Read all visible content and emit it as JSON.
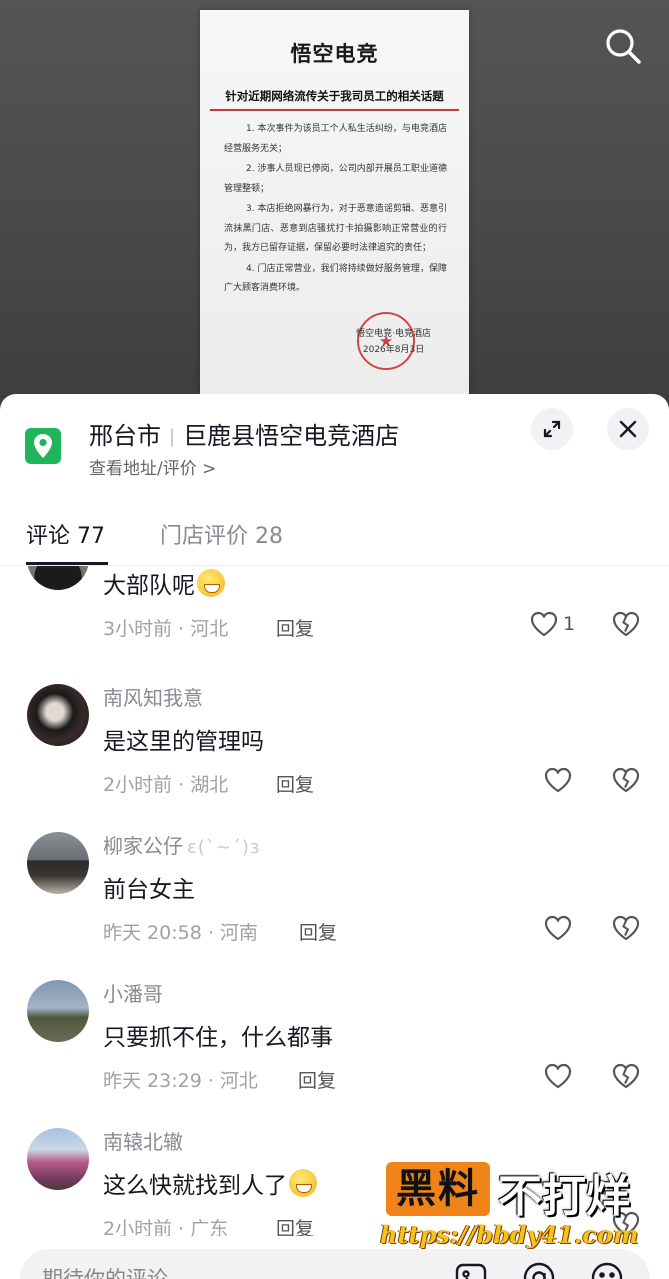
{
  "notice": {
    "logo": "悟空电竞",
    "title": "针对近期网络流传关于我司员工的相关话题",
    "items": [
      "1. 本次事件为该员工个人私生活纠纷，与电竞酒店经营服务无关；",
      "2. 涉事人员现已停岗，公司内部开展员工职业道德管理整顿；",
      "3. 本店拒绝网暴行为，对于恶意造谣剪辑、恶意引流抹黑门店、恶意到店骚扰打卡拍摄影响正常营业的行为，我方已留存证据，保留必要时法律追究的责任；",
      "4. 门店正常营业，我们将持续做好服务管理，保障广大顾客消费环境。"
    ],
    "signature": "悟空电竞·电竞酒店",
    "date": "2026年8月3日"
  },
  "poi": {
    "city": "邢台市",
    "name": "巨鹿县悟空电竞酒店",
    "subtitle": "查看地址/评价 >"
  },
  "tabs": {
    "comments": "评论 77",
    "reviews": "门店评价 28"
  },
  "comments": [
    {
      "user": "",
      "text": "大部队呢",
      "meta": "3小时前 · 河北",
      "reply": "回复",
      "likes": "1"
    },
    {
      "user": "南风知我意",
      "text": "是这里的管理吗",
      "meta": "2小时前 · 湖北",
      "reply": "回复",
      "likes": ""
    },
    {
      "user": "柳家公仔",
      "text": "前台女主",
      "meta": "昨天 20:58 · 河南",
      "reply": "回复",
      "likes": ""
    },
    {
      "user": "小潘哥",
      "text": "只要抓不住，什么都事",
      "meta": "昨天 23:29 · 河北",
      "reply": "回复",
      "likes": ""
    },
    {
      "user": "南辕北辙",
      "text": "这么快就找到人了",
      "meta": "2小时前 · 广东",
      "reply": "回复",
      "likes": ""
    }
  ],
  "watermark": {
    "black_label": "黑料",
    "white_label": "不打烊",
    "url": "https://bbdy41.com"
  },
  "input": {
    "placeholder": "期待你的评论"
  },
  "colors": {
    "poi_green": "#22b35d",
    "watermark_orange": "#f08418",
    "url_yellow": "#f7c31a"
  }
}
